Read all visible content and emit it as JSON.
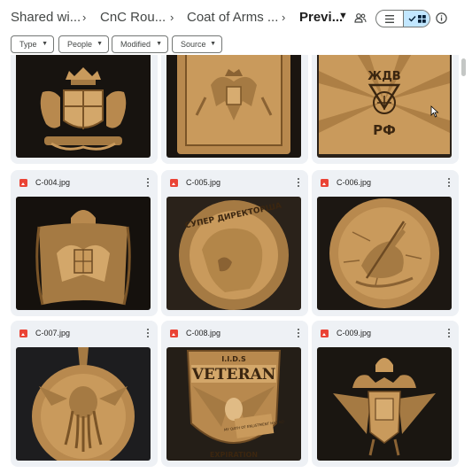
{
  "breadcrumb": {
    "items": [
      "Shared wi...",
      "CnC Rou...",
      "Coat of Arms ...",
      "Previ..."
    ],
    "separator": "›"
  },
  "toolbar": {
    "share_icon": "people-icon",
    "view_list_icon": "list-icon",
    "view_grid_icon": "grid-icon",
    "info_icon": "info-icon"
  },
  "filters": [
    {
      "label": "Type"
    },
    {
      "label": "People"
    },
    {
      "label": "Modified"
    },
    {
      "label": "Source"
    }
  ],
  "files": [
    {
      "name": "",
      "thumb": "canada-arms"
    },
    {
      "name": "",
      "thumb": "russian-eagle-frame"
    },
    {
      "name": "",
      "thumb": "zhdv-rf-emblem"
    },
    {
      "name": "C-004.jpg",
      "thumb": "eagle-mantle"
    },
    {
      "name": "C-005.jpg",
      "thumb": "portrait-medallion"
    },
    {
      "name": "C-006.jpg",
      "thumb": "st-george-medallion"
    },
    {
      "name": "C-007.jpg",
      "thumb": "cthulhu-medallion"
    },
    {
      "name": "C-008.jpg",
      "thumb": "veteran-eagle"
    },
    {
      "name": "C-009.jpg",
      "thumb": "double-headed-eagle"
    }
  ],
  "thumb_text": {
    "zhdv_top": "ЖДВ",
    "zhdv_bottom": "РФ",
    "portrait_ring": "СУПЕР ДИРЕКТОРША",
    "veteran": "VETERAN",
    "veteran_small": "I.I.D.S",
    "veteran_oath": "MY OATH OF ENLISTMENT HAS NO",
    "veteran_footer": "EXPIRATION"
  },
  "colors": {
    "wood": "#c99a5c",
    "wood_dark": "#8a6233",
    "accent_selected": "#c2e7ff",
    "card_bg": "#eef1f5",
    "image_icon": "#ea4335"
  }
}
